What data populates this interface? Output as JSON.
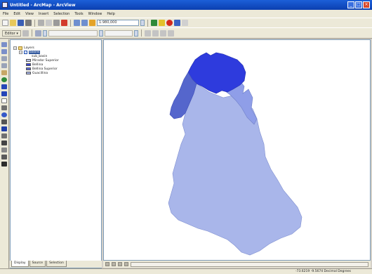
{
  "window": {
    "title": "Untitled - ArcMap - ArcView",
    "buttons": {
      "minimize": "_",
      "maximize": "□",
      "close": "×"
    }
  },
  "menu": [
    "File",
    "Edit",
    "View",
    "Insert",
    "Selection",
    "Tools",
    "Window",
    "Help"
  ],
  "toolbar": {
    "scale": "1:980,000",
    "editor_label": "Editor ▾"
  },
  "toc": {
    "root_label": "Layers",
    "group_label": "basins",
    "group_sublabel": "sub_basin",
    "layers": [
      {
        "label": "Mirador Superior",
        "color": "#b9c4ee"
      },
      {
        "label": "Bellina",
        "color": "#3645d8"
      },
      {
        "label": "Bellina Superior",
        "color": "#5a6ad6"
      },
      {
        "label": "Guacillina",
        "color": "#a7b4e8"
      }
    ],
    "tabs": [
      "Display",
      "Source",
      "Selection"
    ]
  },
  "map": {
    "colors": {
      "north_dark": "#2e3bdd",
      "west_mid": "#5566cc",
      "east_mid": "#8f9ee8",
      "main_body": "#a9b6ea",
      "outline": "#7080c8"
    }
  },
  "status": {
    "coordinates": "-73.6219  -9.5674 Decimal Degrees"
  }
}
